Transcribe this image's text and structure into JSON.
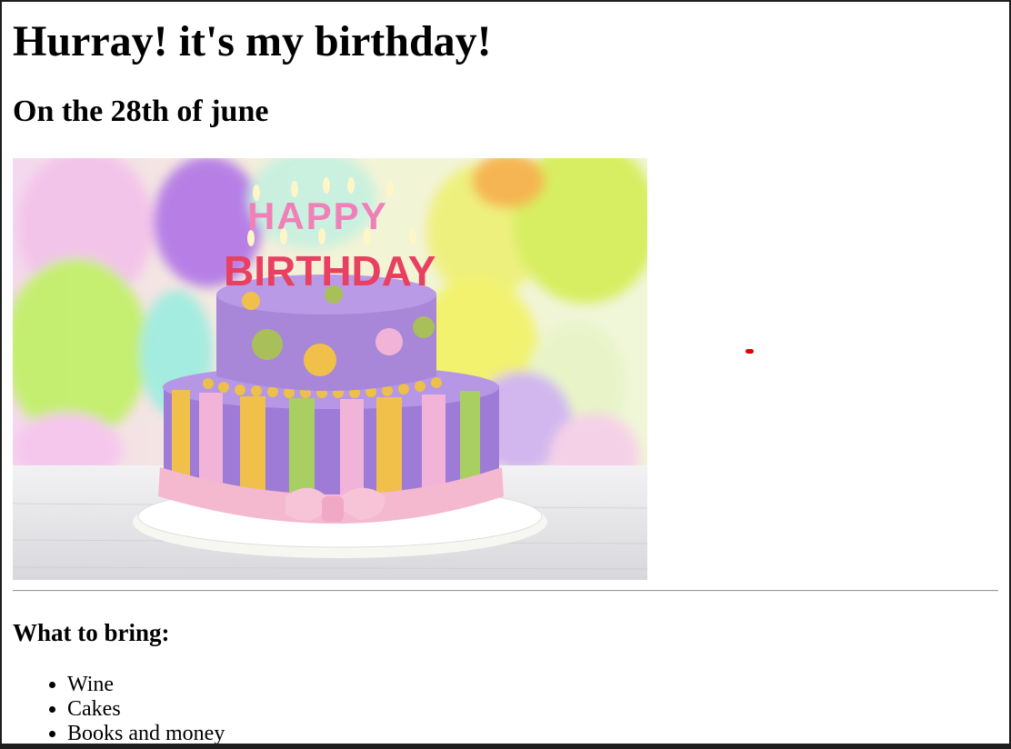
{
  "page": {
    "heading": "Hurray! it's my birthday!",
    "subheading": "On the 28th of june",
    "image": {
      "description_icon": "birthday-cake-image",
      "cake_text_top": "HAPPY",
      "cake_text_bottom": "BIRTHDAY"
    },
    "list_heading": "What to bring:",
    "list_items": [
      "Wine",
      "Cakes",
      "Books and money"
    ]
  },
  "colors": {
    "background": "#ffffff",
    "frame": "#1e1e1e",
    "text": "#000000",
    "marker": "#e00000"
  }
}
